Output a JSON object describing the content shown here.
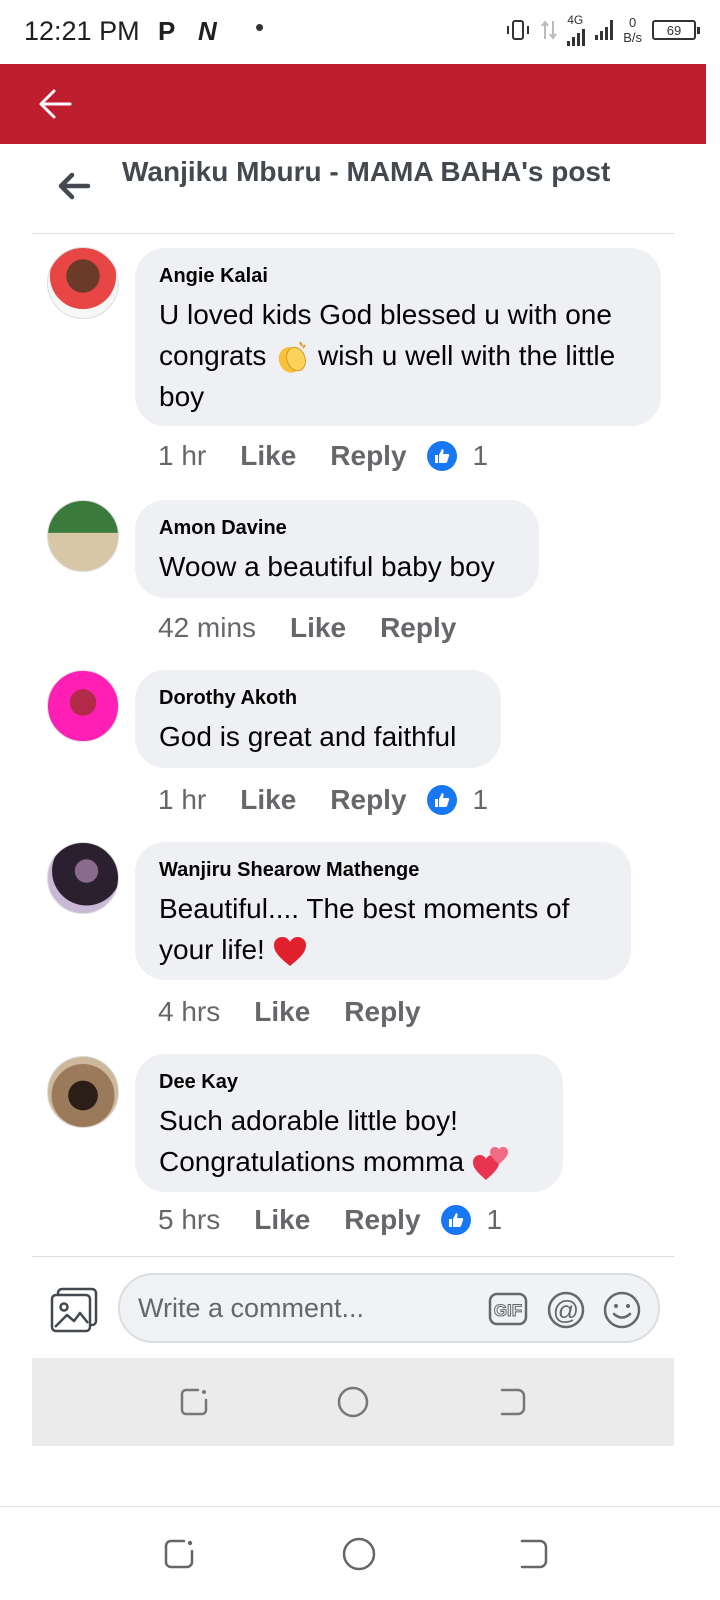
{
  "status_bar": {
    "time": "12:21 PM",
    "network_type": "4G",
    "speed_value": "0",
    "speed_unit": "B/s",
    "battery": "69"
  },
  "post": {
    "title": "Wanjiku Mburu - MAMA BAHA's post"
  },
  "comments": [
    {
      "author": "Angie Kalai",
      "text": "U loved kids God blessed u with one congrats",
      "text_tail": "wish u well with the little boy",
      "emoji": "clapping-hands",
      "time": "1 hr",
      "like": "Like",
      "reply": "Reply",
      "reactions": "1"
    },
    {
      "author": "Amon Davine",
      "text": "Woow a beautiful baby boy",
      "time": "42 mins",
      "like": "Like",
      "reply": "Reply"
    },
    {
      "author": "Dorothy Akoth",
      "text": "God is great and faithful",
      "time": "1 hr",
      "like": "Like",
      "reply": "Reply",
      "reactions": "1"
    },
    {
      "author": "Wanjiru Shearow Mathenge",
      "text": "Beautiful.... The best moments of your life!",
      "emoji": "red-heart",
      "time": "4 hrs",
      "like": "Like",
      "reply": "Reply"
    },
    {
      "author": "Dee Kay",
      "text": "Such adorable little boy! Congratulations momma",
      "emoji": "two-hearts",
      "time": "5 hrs",
      "like": "Like",
      "reply": "Reply",
      "reactions": "1"
    }
  ],
  "composer": {
    "placeholder": "Write a comment...",
    "gif_label": "GIF",
    "mention_label": "@"
  },
  "colors": {
    "app_bar": "#be1e2d",
    "bubble": "#eff0f4",
    "like_blue": "#1877f2",
    "meta_text": "#65676b"
  }
}
